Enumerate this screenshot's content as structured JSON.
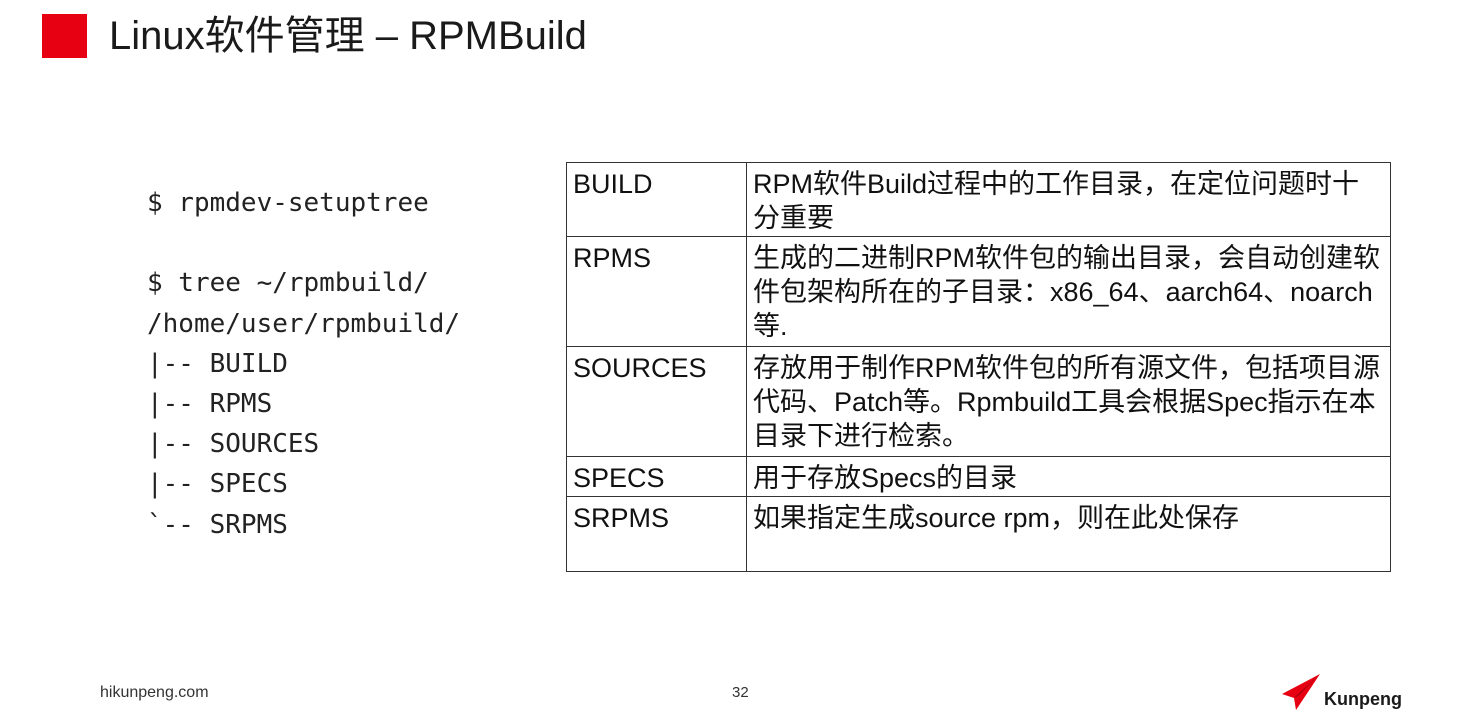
{
  "title": "Linux软件管理 – RPMBuild",
  "accent_color": "#e60012",
  "code_lines": [
    "$ rpmdev-setuptree",
    "",
    "$ tree ~/rpmbuild/",
    "/home/user/rpmbuild/",
    "|-- BUILD",
    "|-- RPMS",
    "|-- SOURCES",
    "|-- SPECS",
    "`-- SRPMS"
  ],
  "table": {
    "rows": [
      {
        "name": "BUILD",
        "desc": "RPM软件Build过程中的工作目录，在定位问题时十分重要"
      },
      {
        "name": "RPMS",
        "desc": "生成的二进制RPM软件包的输出目录，会自动创建软件包架构所在的子目录：x86_64、aarch64、noarch等."
      },
      {
        "name": "SOURCES",
        "desc": "存放用于制作RPM软件包的所有源文件，包括项目源代码、Patch等。Rpmbuild工具会根据Spec指示在本目录下进行检索。"
      },
      {
        "name": "SPECS",
        "desc": "用于存放Specs的目录"
      },
      {
        "name": "SRPMS",
        "desc": "如果指定生成source rpm，则在此处保存"
      }
    ]
  },
  "footer": {
    "website": "hikunpeng.com",
    "page_number": "32",
    "logo_text": "Kunpeng",
    "logo_icon": "kunpeng-logo-icon"
  }
}
